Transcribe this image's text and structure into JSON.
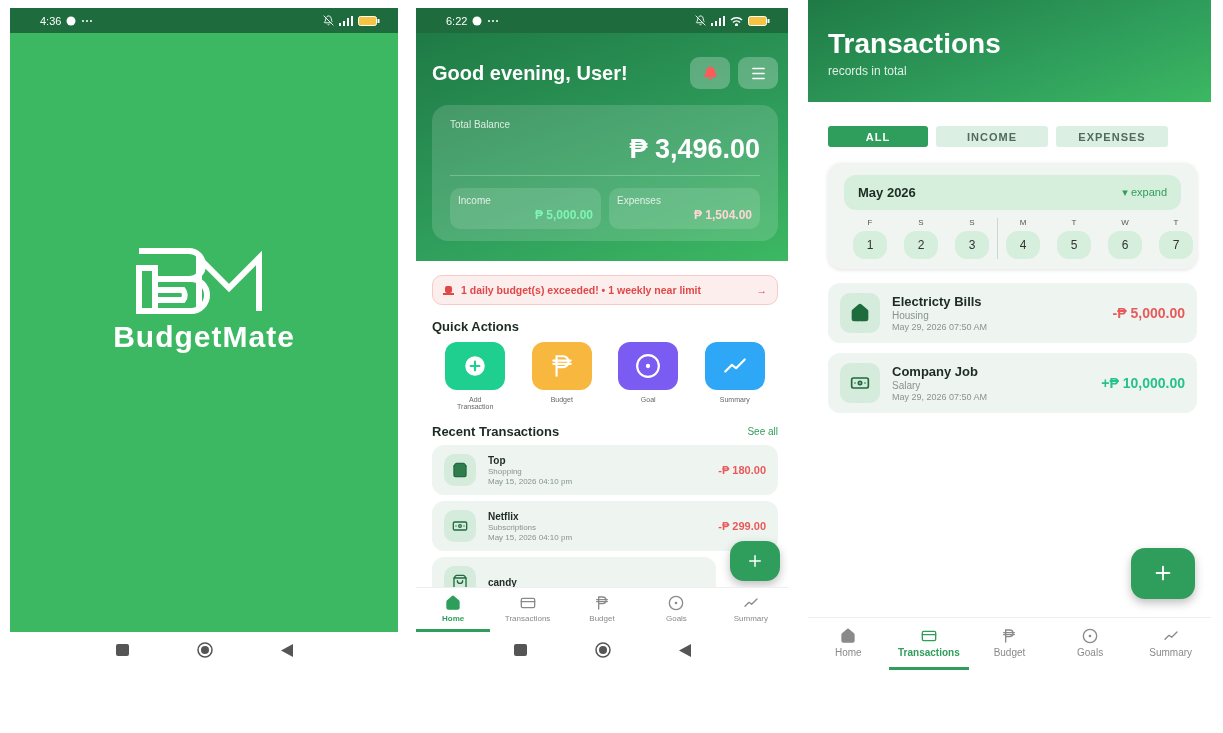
{
  "splash_screen": {
    "status_bar": {
      "time": "4:36"
    },
    "app_name": "BudgetMate"
  },
  "home_screen": {
    "status_bar": {
      "time": "6:22"
    },
    "greeting": "Good evening, User!",
    "balance": {
      "label": "Total Balance",
      "amount": "₱ 3,496.00",
      "income_label": "Income",
      "income": "₱ 5,000.00",
      "expenses_label": "Expenses",
      "expenses": "₱ 1,504.00"
    },
    "alert": {
      "message": "1 daily budget(s) exceeded!  •  1 weekly near limit",
      "arrow": "→"
    },
    "quick_actions_title": "Quick Actions",
    "quick_actions": [
      {
        "label": "Add Transaction",
        "color": "#1fcf8f"
      },
      {
        "label": "Budget",
        "color": "#f8b73e"
      },
      {
        "label": "Goal",
        "color": "#7a5cf2"
      },
      {
        "label": "Summary",
        "color": "#2ea8f6"
      }
    ],
    "recent_title": "Recent Transactions",
    "see_all": "See all",
    "transactions": [
      {
        "title": "Top",
        "category": "Shopping",
        "date": "May 15, 2026  04:10 pm",
        "amount": "-₱ 180.00",
        "kind": "expense"
      },
      {
        "title": "Netflix",
        "category": "Subscriptions",
        "date": "May 15, 2026  04:10 pm",
        "amount": "-₱ 299.00",
        "kind": "expense"
      },
      {
        "title": "candy"
      }
    ],
    "nav": [
      {
        "label": "Home",
        "selected": true
      },
      {
        "label": "Transactions",
        "selected": false
      },
      {
        "label": "Budget",
        "selected": false
      },
      {
        "label": "Goals",
        "selected": false
      },
      {
        "label": "Summary",
        "selected": false
      }
    ]
  },
  "transactions_screen": {
    "title": "Transactions",
    "subtitle": "records in total",
    "filters": [
      {
        "label": "ALL",
        "selected": true
      },
      {
        "label": "INCOME",
        "selected": false
      },
      {
        "label": "EXPENSES",
        "selected": false
      }
    ],
    "calendar": {
      "month": "May 2026",
      "toggle": "▾ expand",
      "days": [
        {
          "weekday": "F",
          "day": "1",
          "week_start": false
        },
        {
          "weekday": "S",
          "day": "2",
          "week_start": false
        },
        {
          "weekday": "S",
          "day": "3",
          "week_start": false
        },
        {
          "weekday": "M",
          "day": "4",
          "week_start": true
        },
        {
          "weekday": "T",
          "day": "5",
          "week_start": false
        },
        {
          "weekday": "W",
          "day": "6",
          "week_start": false
        },
        {
          "weekday": "T",
          "day": "7",
          "week_start": false
        }
      ]
    },
    "transactions": [
      {
        "title": "Electricty Bills",
        "category": "Housing",
        "date": "May 29, 2026  07:50 AM",
        "amount": "-₱ 5,000.00",
        "kind": "expense"
      },
      {
        "title": "Company Job",
        "category": "Salary",
        "date": "May 29, 2026  07:50 AM",
        "amount": "+₱ 10,000.00",
        "kind": "income"
      }
    ],
    "nav": [
      {
        "label": "Home",
        "selected": false
      },
      {
        "label": "Transactions",
        "selected": true
      },
      {
        "label": "Budget",
        "selected": false
      },
      {
        "label": "Goals",
        "selected": false
      },
      {
        "label": "Summary",
        "selected": false
      }
    ]
  }
}
